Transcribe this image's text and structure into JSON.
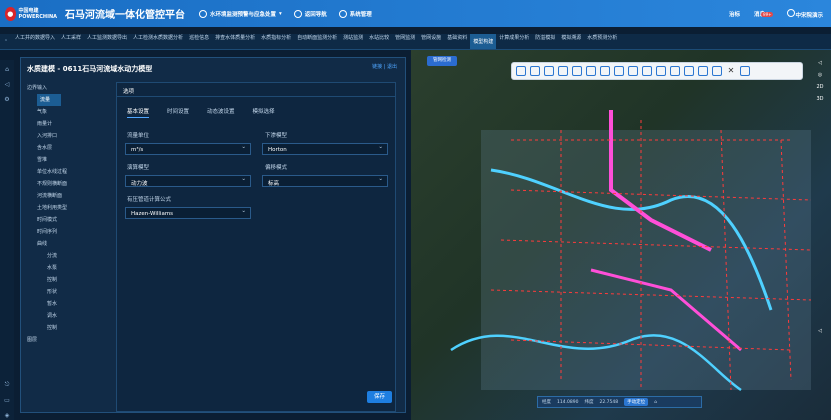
{
  "header": {
    "logo_line1": "中国电建",
    "logo_line2": "POWERCHINA",
    "title": "石马河流域一体化管控平台",
    "menu": [
      "水环境监测预警与应急处置",
      "返回导航",
      "系统管理"
    ],
    "right": [
      "治标",
      "消息",
      "中宋院演示"
    ],
    "badge": "99+"
  },
  "nav": {
    "items": [
      "人工井的数据导入",
      "人工采样",
      "人工监测数据导出",
      "人工检测水质数据分析",
      "巡检信息",
      "排查水体质量分析",
      "水质指标分析",
      "自动断面监测分析",
      "测站监测",
      "水站比较",
      "管网监测",
      "管网设施",
      "基础资料",
      "模型构建",
      "计算成果分析",
      "防溢模拟",
      "模拟溯源",
      "水质预测分析"
    ],
    "active_index": 13
  },
  "panel": {
    "title": "水质建模 - 0611石马河流域水动力模型",
    "actions": [
      "链接",
      "退出"
    ],
    "tree": [
      "边界输入",
      "流量",
      "气象",
      "雨量计",
      "入河排口",
      "含水层",
      "雪堆",
      "单位水线过程",
      "不规则横断面",
      "河流横断面",
      "土地利用类型",
      "时间模式",
      "时间序列",
      "曲线",
      "分流",
      "水泵",
      "控制",
      "形状",
      "暂水",
      "调水",
      "控制",
      "图层"
    ],
    "tree_selected": "流量",
    "content": {
      "section": "选项",
      "tabs": [
        "基本设置",
        "时间设置",
        "动态波设置",
        "模拟选择"
      ],
      "active_tab": 0,
      "fields": [
        {
          "label": "流量单位",
          "value": "m³/s"
        },
        {
          "label": "下渗模型",
          "value": "Horton"
        },
        {
          "label": "演算模型",
          "value": "动力波"
        },
        {
          "label": "偏移模式",
          "value": "标高"
        },
        {
          "label": "有压管道计算公式",
          "value": "Hazen-Williams"
        }
      ],
      "save": "保存"
    }
  },
  "map": {
    "chip": "管网检测",
    "status": {
      "lng_label": "经度",
      "lng": "114.0890",
      "lat_label": "纬度",
      "lat": "22.7548",
      "locate": "手动定位"
    },
    "right_tools": [
      "2D",
      "3D"
    ]
  }
}
